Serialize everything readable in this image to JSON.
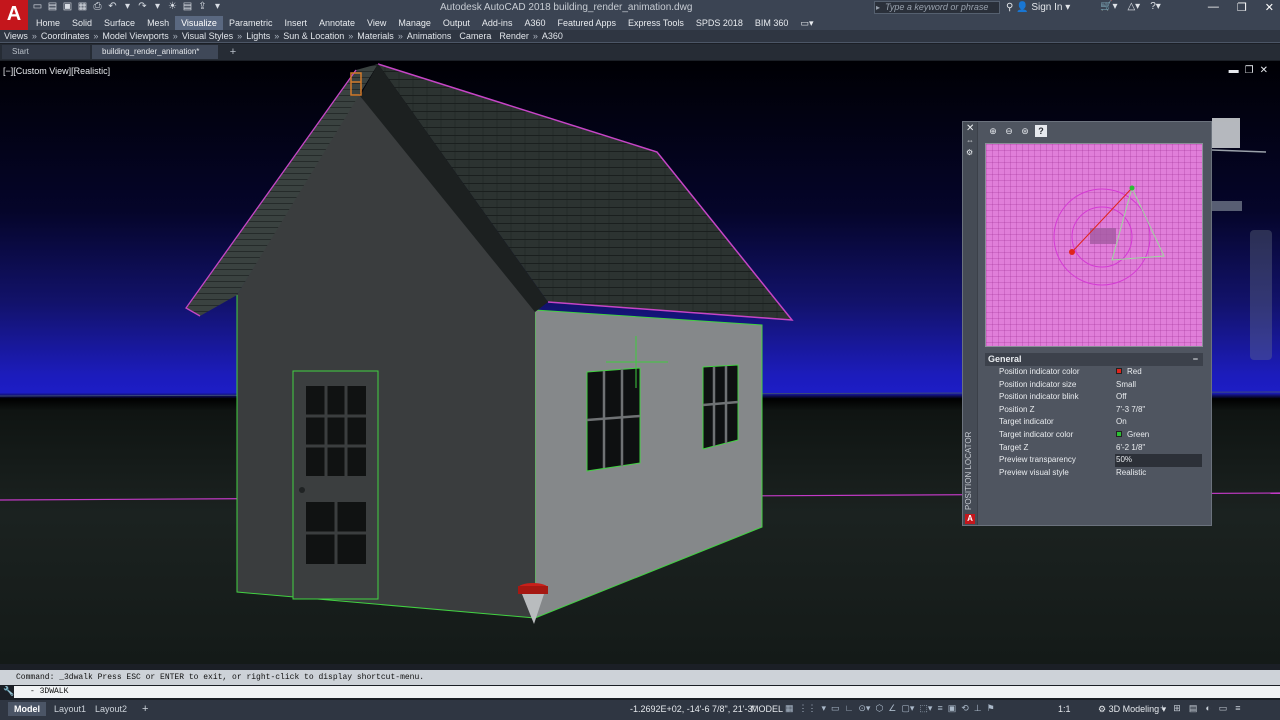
{
  "titlebar": {
    "app_title": "Autodesk AutoCAD 2018    building_render_animation.dwg",
    "search_placeholder": "Type a keyword or phrase",
    "sign_in": "Sign In",
    "logo_letter": "A"
  },
  "ribbon": {
    "tabs": [
      "Home",
      "Solid",
      "Surface",
      "Mesh",
      "Visualize",
      "Parametric",
      "Insert",
      "Annotate",
      "View",
      "Manage",
      "Output",
      "Add-ins",
      "A360",
      "Featured Apps",
      "Express Tools",
      "SPDS 2018",
      "BIM 360"
    ],
    "active_tab": "Visualize",
    "panels": [
      "Views",
      "Coordinates",
      "Model Viewports",
      "Visual Styles",
      "Lights",
      "Sun & Location",
      "Materials",
      "Animations",
      "Camera",
      "Render",
      "A360"
    ]
  },
  "doc_tabs": {
    "start": "Start",
    "file": "building_render_animation*",
    "add": "+"
  },
  "viewport": {
    "label": "[−][Custom View][Realistic]"
  },
  "palette": {
    "title": "POSITION LOCATOR",
    "section": "General",
    "collapse": "−",
    "properties": [
      {
        "name": "Position indicator color",
        "value": "Red",
        "swatch": "#e0241c"
      },
      {
        "name": "Position indicator size",
        "value": "Small"
      },
      {
        "name": "Position indicator blink",
        "value": "Off"
      },
      {
        "name": "Position Z",
        "value": "7'-3 7/8\""
      },
      {
        "name": "Target indicator",
        "value": "On"
      },
      {
        "name": "Target indicator color",
        "value": "Green",
        "swatch": "#2bbf33"
      },
      {
        "name": "Target Z",
        "value": "6'-2 1/8\""
      },
      {
        "name": "Preview transparency",
        "value": "50%"
      },
      {
        "name": "Preview visual style",
        "value": "Realistic"
      }
    ],
    "selected_property": "Preview transparency"
  },
  "command": {
    "history": "Command: _3dwalk Press ESC or ENTER to exit, or right-click to display shortcut-menu.",
    "input": "- 3DWALK"
  },
  "statusbar": {
    "layouts": [
      "Model",
      "Layout1",
      "Layout2"
    ],
    "active_layout": "Model",
    "add": "+",
    "coords": "-1.2692E+02, -14'-6 7/8\", 21'-3\"",
    "space": "MODEL",
    "scale": "1:1",
    "workspace": "3D Modeling"
  },
  "colors": {
    "accent": "#c4161c",
    "selection_magenta": "#d23cd2",
    "target_green": "#2bbf33"
  }
}
